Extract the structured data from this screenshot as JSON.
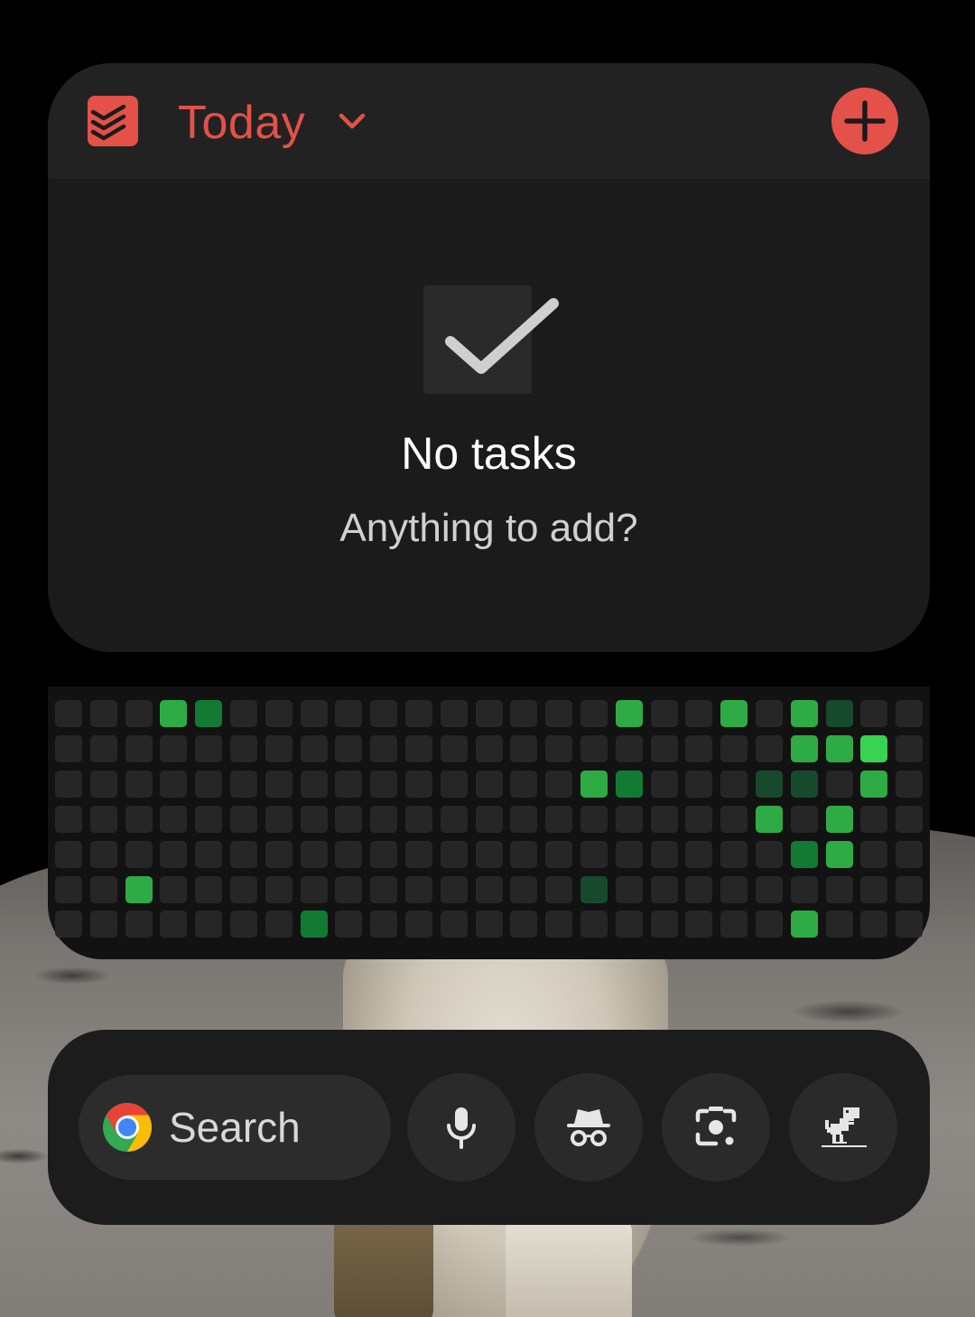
{
  "todo_widget": {
    "title": "Today",
    "empty_title": "No tasks",
    "empty_subtitle": "Anything to add?",
    "accent_color": "#e35149",
    "icons": [
      "todoist-logo-icon",
      "chevron-down-icon",
      "add-icon",
      "checkmark-icon"
    ]
  },
  "activity_grid": {
    "rows": 7,
    "columns": 25,
    "colors": {
      "0": "#262626",
      "1": "#174a2c",
      "2": "#137a34",
      "3": "#2fab45",
      "4": "#39d353"
    },
    "levels": [
      [
        0,
        0,
        0,
        3,
        2,
        0,
        0,
        0,
        0,
        0,
        0,
        0,
        0,
        0,
        0,
        0,
        3,
        0,
        0,
        3,
        0,
        3,
        1,
        0,
        0
      ],
      [
        0,
        0,
        0,
        0,
        0,
        0,
        0,
        0,
        0,
        0,
        0,
        0,
        0,
        0,
        0,
        0,
        0,
        0,
        0,
        0,
        0,
        3,
        3,
        4,
        0
      ],
      [
        0,
        0,
        0,
        0,
        0,
        0,
        0,
        0,
        0,
        0,
        0,
        0,
        0,
        0,
        0,
        3,
        2,
        0,
        0,
        0,
        1,
        1,
        0,
        3,
        0
      ],
      [
        0,
        0,
        0,
        0,
        0,
        0,
        0,
        0,
        0,
        0,
        0,
        0,
        0,
        0,
        0,
        0,
        0,
        0,
        0,
        0,
        3,
        0,
        3,
        0,
        0
      ],
      [
        0,
        0,
        0,
        0,
        0,
        0,
        0,
        0,
        0,
        0,
        0,
        0,
        0,
        0,
        0,
        0,
        0,
        0,
        0,
        0,
        0,
        2,
        3,
        0,
        0
      ],
      [
        0,
        0,
        3,
        0,
        0,
        0,
        0,
        0,
        0,
        0,
        0,
        0,
        0,
        0,
        0,
        1,
        0,
        0,
        0,
        0,
        0,
        0,
        0,
        0,
        0
      ],
      [
        0,
        0,
        0,
        0,
        0,
        0,
        0,
        2,
        0,
        0,
        0,
        0,
        0,
        0,
        0,
        0,
        0,
        0,
        0,
        0,
        0,
        3,
        0,
        0,
        0
      ]
    ]
  },
  "chrome_widget": {
    "search_label": "Search",
    "icons": [
      "chrome-logo-icon",
      "microphone-icon",
      "incognito-icon",
      "lens-camera-icon",
      "dino-game-icon"
    ]
  }
}
